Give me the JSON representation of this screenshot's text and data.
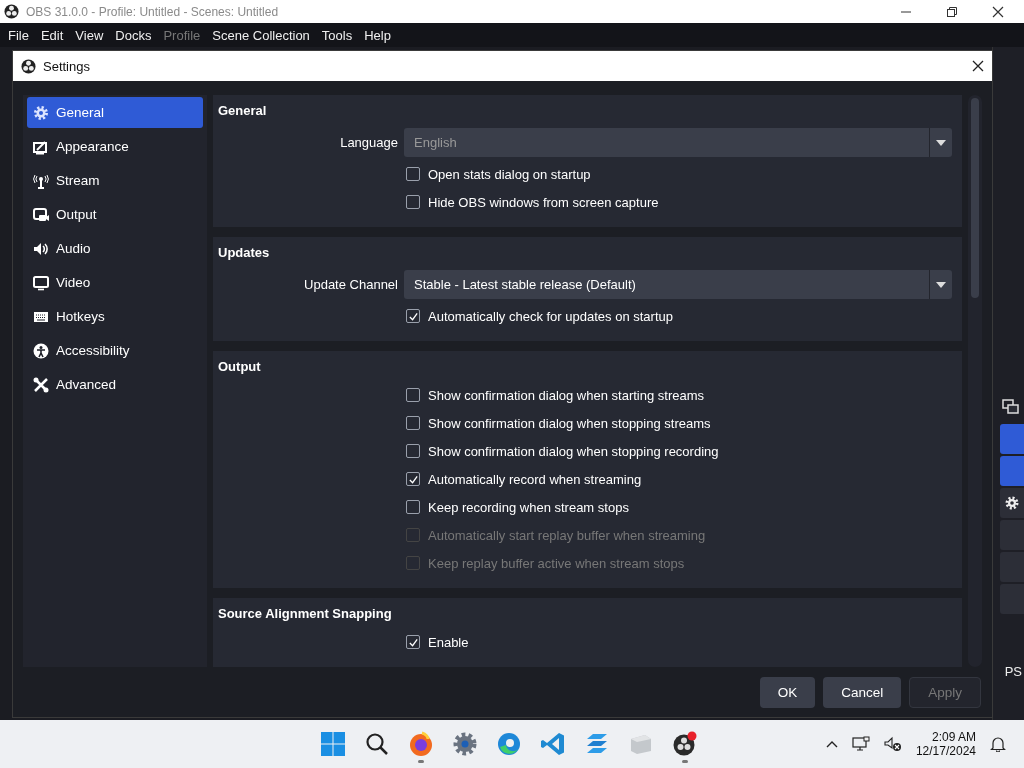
{
  "app": {
    "title": "OBS 31.0.0 - Profile: Untitled - Scenes: Untitled"
  },
  "menu": [
    {
      "label": "File",
      "disabled": false
    },
    {
      "label": "Edit",
      "disabled": false
    },
    {
      "label": "View",
      "disabled": false
    },
    {
      "label": "Docks",
      "disabled": false
    },
    {
      "label": "Profile",
      "disabled": true
    },
    {
      "label": "Scene Collection",
      "disabled": false
    },
    {
      "label": "Tools",
      "disabled": false
    },
    {
      "label": "Help",
      "disabled": false
    }
  ],
  "background_window": {
    "status_text": "PS"
  },
  "dialog": {
    "title": "Settings",
    "sidebar": [
      {
        "label": "General",
        "selected": true
      },
      {
        "label": "Appearance",
        "selected": false
      },
      {
        "label": "Stream",
        "selected": false
      },
      {
        "label": "Output",
        "selected": false
      },
      {
        "label": "Audio",
        "selected": false
      },
      {
        "label": "Video",
        "selected": false
      },
      {
        "label": "Hotkeys",
        "selected": false
      },
      {
        "label": "Accessibility",
        "selected": false
      },
      {
        "label": "Advanced",
        "selected": false
      }
    ],
    "sections": [
      {
        "title": "General",
        "rows": [
          {
            "kind": "dropdown",
            "label": "Language",
            "value": "English",
            "disabled": true
          },
          {
            "kind": "checkbox",
            "label": "Open stats dialog on startup",
            "checked": false,
            "disabled": false
          },
          {
            "kind": "checkbox",
            "label": "Hide OBS windows from screen capture",
            "checked": false,
            "disabled": false
          }
        ]
      },
      {
        "title": "Updates",
        "rows": [
          {
            "kind": "dropdown",
            "label": "Update Channel",
            "value": "Stable - Latest stable release (Default)",
            "disabled": false
          },
          {
            "kind": "checkbox",
            "label": "Automatically check for updates on startup",
            "checked": true,
            "disabled": false
          }
        ]
      },
      {
        "title": "Output",
        "rows": [
          {
            "kind": "checkbox",
            "label": "Show confirmation dialog when starting streams",
            "checked": false,
            "disabled": false
          },
          {
            "kind": "checkbox",
            "label": "Show confirmation dialog when stopping streams",
            "checked": false,
            "disabled": false
          },
          {
            "kind": "checkbox",
            "label": "Show confirmation dialog when stopping recording",
            "checked": false,
            "disabled": false
          },
          {
            "kind": "checkbox",
            "label": "Automatically record when streaming",
            "checked": true,
            "disabled": false
          },
          {
            "kind": "checkbox",
            "label": "Keep recording when stream stops",
            "checked": false,
            "disabled": false
          },
          {
            "kind": "checkbox",
            "label": "Automatically start replay buffer when streaming",
            "checked": false,
            "disabled": true
          },
          {
            "kind": "checkbox",
            "label": "Keep replay buffer active when stream stops",
            "checked": false,
            "disabled": true
          }
        ]
      },
      {
        "title": "Source Alignment Snapping",
        "rows": [
          {
            "kind": "checkbox",
            "label": "Enable",
            "checked": true,
            "disabled": false
          }
        ]
      }
    ],
    "buttons": [
      {
        "label": "OK",
        "disabled": false
      },
      {
        "label": "Cancel",
        "disabled": false
      },
      {
        "label": "Apply",
        "disabled": true
      }
    ]
  },
  "taskbar": {
    "apps": [
      {
        "running": false
      },
      {
        "running": false
      },
      {
        "running": true
      },
      {
        "running": false
      },
      {
        "running": false
      },
      {
        "running": false
      },
      {
        "running": false
      },
      {
        "running": false
      },
      {
        "running": true
      }
    ],
    "time": "2:09 AM",
    "date": "12/17/2024"
  }
}
